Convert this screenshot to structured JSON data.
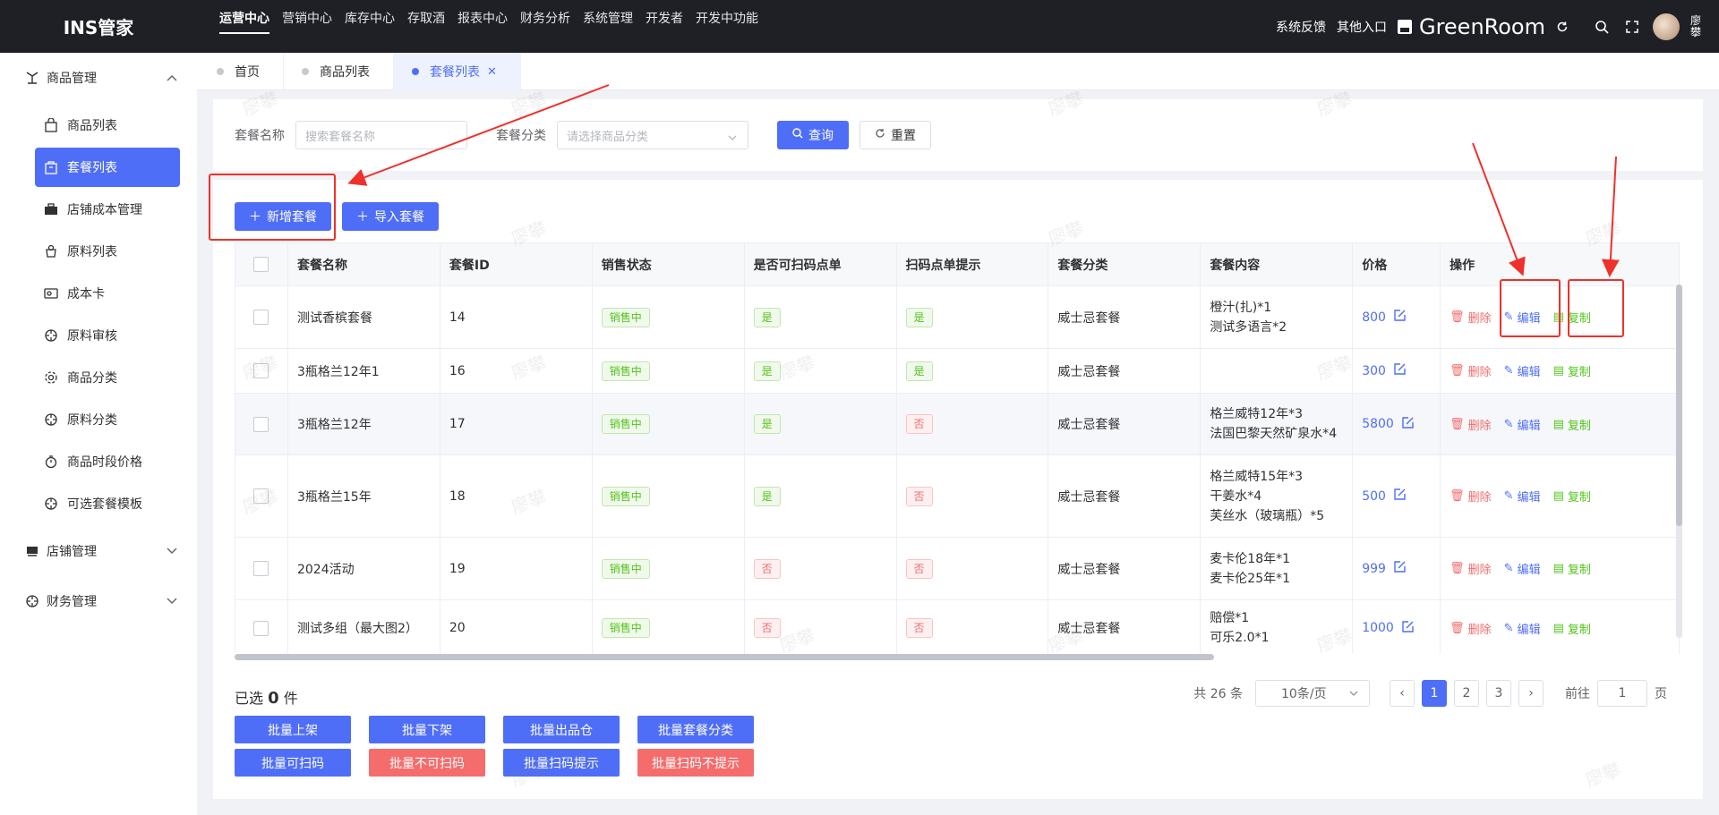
{
  "brand": "INS管家",
  "topnav": [
    "运营中心",
    "营销中心",
    "库存中心",
    "存取酒",
    "报表中心",
    "财务分析",
    "系统管理",
    "开发者",
    "开发中功能"
  ],
  "topright": {
    "feedback": "系统反馈",
    "other": "其他入口",
    "store": "GreenRoom",
    "user": "廖攀"
  },
  "sidebar": {
    "group1": "商品管理",
    "items": [
      "商品列表",
      "套餐列表",
      "店铺成本管理",
      "原料列表",
      "成本卡",
      "原料审核",
      "商品分类",
      "原料分类",
      "商品时段价格",
      "可选套餐模板"
    ],
    "group2": "店铺管理",
    "group3": "财务管理"
  },
  "tabs": [
    "首页",
    "商品列表",
    "套餐列表"
  ],
  "search": {
    "name_label": "套餐名称",
    "name_placeholder": "搜索套餐名称",
    "category_label": "套餐分类",
    "category_placeholder": "请选择商品分类",
    "query": "查询",
    "reset": "重置"
  },
  "toolbar": {
    "add": "新增套餐",
    "import": "导入套餐"
  },
  "table": {
    "headers": [
      "套餐名称",
      "套餐ID",
      "销售状态",
      "是否可扫码点单",
      "扫码点单提示",
      "套餐分类",
      "套餐内容",
      "价格",
      "操作"
    ],
    "rows": [
      {
        "name": "测试香槟套餐",
        "id": "14",
        "status": "销售中",
        "scan": "是",
        "hint": "是",
        "category": "威士忌套餐",
        "content": [
          "橙汁(扎)*1",
          "测试多语言*2"
        ],
        "price": "800"
      },
      {
        "name": "3瓶格兰12年1",
        "id": "16",
        "status": "销售中",
        "scan": "是",
        "hint": "是",
        "category": "威士忌套餐",
        "content": [],
        "price": "300"
      },
      {
        "name": "3瓶格兰12年",
        "id": "17",
        "status": "销售中",
        "scan": "是",
        "hint": "否",
        "category": "威士忌套餐",
        "content": [
          "格兰威特12年*3",
          "法国巴黎天然矿泉水*4"
        ],
        "price": "5800"
      },
      {
        "name": "3瓶格兰15年",
        "id": "18",
        "status": "销售中",
        "scan": "是",
        "hint": "否",
        "category": "威士忌套餐",
        "content": [
          "格兰威特15年*3",
          "干姜水*4",
          "芙丝水（玻璃瓶）*5"
        ],
        "price": "500"
      },
      {
        "name": "2024活动",
        "id": "19",
        "status": "销售中",
        "scan": "否",
        "hint": "否",
        "category": "威士忌套餐",
        "content": [
          "麦卡伦18年*1",
          "麦卡伦25年*1"
        ],
        "price": "999"
      },
      {
        "name": "测试多组（最大图2）",
        "id": "20",
        "status": "销售中",
        "scan": "否",
        "hint": "否",
        "category": "威士忌套餐",
        "content": [
          "赔偿*1",
          "可乐2.0*1"
        ],
        "price": "1000"
      }
    ],
    "actions": {
      "delete": "删除",
      "edit": "编辑",
      "copy": "复制"
    }
  },
  "selected": {
    "prefix": "已选",
    "count": "0",
    "suffix": "件"
  },
  "bulk": [
    "批量上架",
    "批量下架",
    "批量出品仓",
    "批量套餐分类",
    "批量可扫码",
    "批量不可扫码",
    "批量扫码提示",
    "批量扫码不提示"
  ],
  "pager": {
    "total": "共 26 条",
    "size": "10条/页",
    "pages": [
      "1",
      "2",
      "3"
    ],
    "goto": "前往",
    "page_value": "1",
    "page_suffix": "页"
  },
  "watermark": "廖攀",
  "colors": {
    "primary": "#4f6ef7",
    "danger": "#f56c6c",
    "success": "#52c41a",
    "topbar": "#1f2026",
    "annotation": "#f0302b"
  }
}
